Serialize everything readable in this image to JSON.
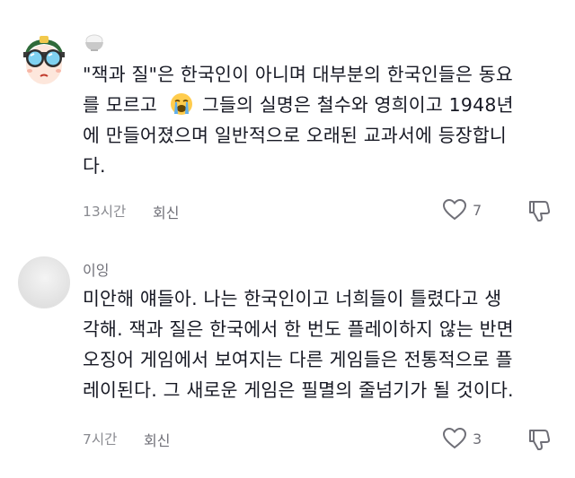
{
  "comments": [
    {
      "username": "",
      "username_emoji": "rice-bowl-icon",
      "avatar": "cartoon-goggles-avatar",
      "lines": [
        "\"잭과 질\"은 한국인이 아니며 대부분의 한국인들은 동요",
        "를 모르고",
        "그들의 실명은 철수와 영희이고 1948년",
        "에 만들어졌으며 일반적으로 오래된 교과서에 등장합니",
        "다."
      ],
      "inline_emoji": "loudly-crying-face-icon",
      "time": "13시간",
      "reply_label": "회신",
      "likes": "7"
    },
    {
      "username": "이잉",
      "avatar": "default-gray-avatar",
      "lines": [
        "미안해 얘들아. 나는 한국인이고 너희들이 틀렸다고 생",
        "각해. 잭과 질은 한국에서 한 번도 플레이하지 않는 반면",
        "오징어 게임에서 보여지는 다른 게임들은 전통적으로 플",
        "레이된다. 그 새로운 게임은 필멸의 줄넘기가 될 것이다."
      ],
      "time": "7시간",
      "reply_label": "회신",
      "likes": "3"
    }
  ],
  "colors": {
    "text": "#161823",
    "secondary": "#8a8b91",
    "icon": "#6f6f77"
  }
}
